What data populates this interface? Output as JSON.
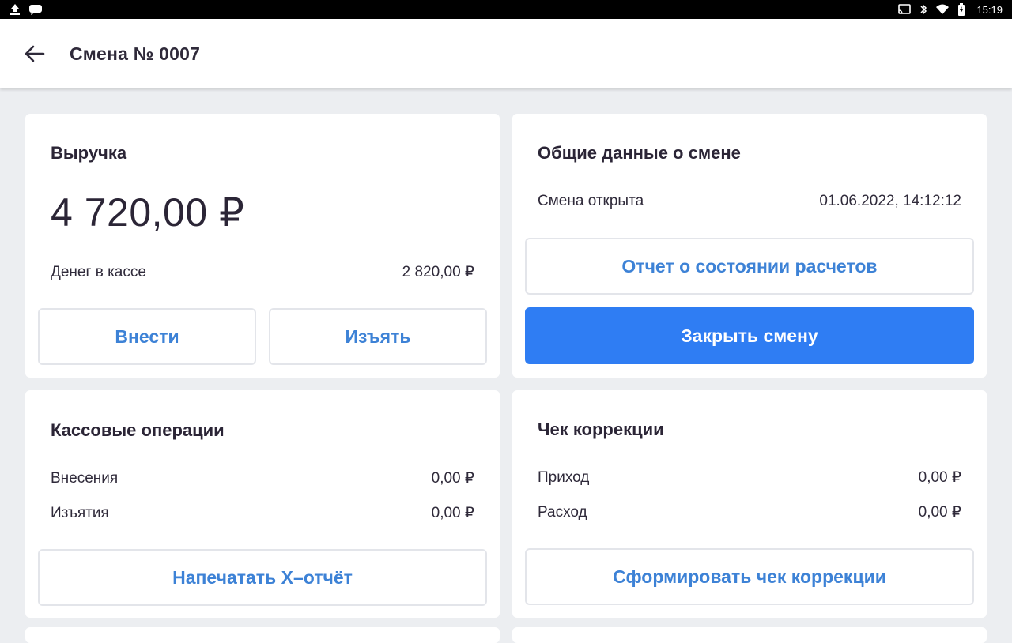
{
  "status_bar": {
    "time": "15:19",
    "left_icons": [
      "upload-icon",
      "message-icon"
    ],
    "right_icons": [
      "cast-icon",
      "bluetooth-icon",
      "wifi-icon",
      "battery-charging-icon"
    ]
  },
  "app_bar": {
    "title": "Смена № 0007",
    "back_icon": "arrow-left-icon"
  },
  "revenue_card": {
    "title": "Выручка",
    "amount": "4 720,00 ₽",
    "cash_label": "Денег в кассе",
    "cash_value": "2 820,00 ₽",
    "deposit_button": "Внести",
    "withdraw_button": "Изъять"
  },
  "shift_info_card": {
    "title": "Общие данные о смене",
    "opened_label": "Смена открыта",
    "opened_value": "01.06.2022, 14:12:12",
    "report_button": "Отчет о состоянии расчетов",
    "close_button": "Закрыть смену"
  },
  "cash_ops_card": {
    "title": "Кассовые операции",
    "rows": [
      {
        "label": "Внесения",
        "value": "0,00 ₽"
      },
      {
        "label": "Изъятия",
        "value": "0,00 ₽"
      }
    ],
    "print_button": "Напечатать X–отчёт"
  },
  "correction_card": {
    "title": "Чек коррекции",
    "rows": [
      {
        "label": "Приход",
        "value": "0,00 ₽"
      },
      {
        "label": "Расход",
        "value": "0,00 ₽"
      }
    ],
    "create_button": "Сформировать чек коррекции"
  },
  "colors": {
    "accent": "#2f7df3",
    "link_blue": "#3d82d6",
    "background": "#eceef1",
    "text": "#2b2536"
  }
}
